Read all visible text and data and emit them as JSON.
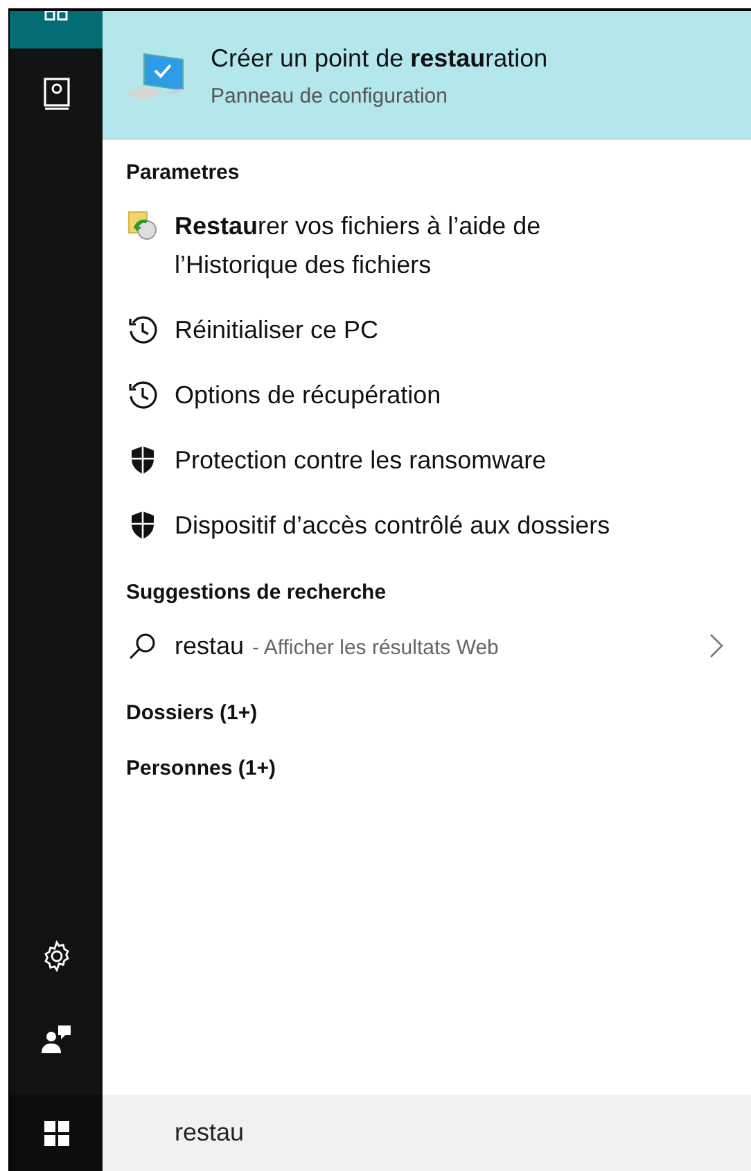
{
  "sidebar": {
    "items": [
      {
        "kind": "home",
        "selected": true
      },
      {
        "kind": "notebook",
        "selected": false
      }
    ],
    "bottom_items": [
      {
        "kind": "settings"
      },
      {
        "kind": "feedback"
      }
    ]
  },
  "best_match": {
    "title": "Créer un point de **restau**ration",
    "subtitle": "Panneau de configuration",
    "selected": true
  },
  "sections": [
    {
      "heading": "Parametres",
      "items": [
        {
          "kind": "file-history",
          "label": "**Restau**rer vos fichiers à l’aide de l’Historique des fichiers"
        },
        {
          "kind": "history",
          "label": "Réinitialiser ce PC"
        },
        {
          "kind": "history",
          "label": "Options de récupération"
        },
        {
          "kind": "shield",
          "label": "Protection contre les ransomware"
        },
        {
          "kind": "shield",
          "label": "Dispositif d’accès contrôlé aux dossiers"
        }
      ]
    },
    {
      "heading": "Suggestions de recherche",
      "items": [
        {
          "kind": "web",
          "label": "restau",
          "hint": "- Afficher les résultats Web"
        }
      ]
    },
    {
      "heading": "Dossiers (1+)"
    },
    {
      "heading": "Personnes (1+)"
    }
  ],
  "search": {
    "value": "restau"
  }
}
